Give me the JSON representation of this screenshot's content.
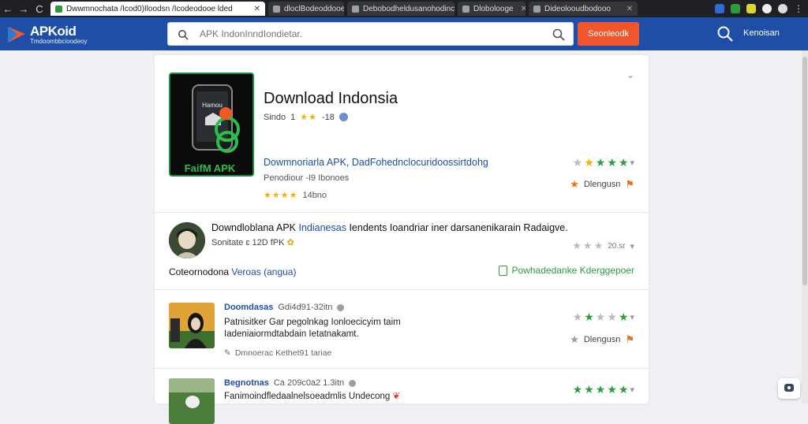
{
  "browser": {
    "nav": {
      "back": "←",
      "forward": "→",
      "reload": "C"
    },
    "tabs": [
      {
        "label": "Dwwmnochata /Icod0)Iloodsn /Icodeodooe lded",
        "active": true
      },
      {
        "label": "dloclBodeoddooe",
        "active": false
      },
      {
        "label": "Debobodheldusanohodinc",
        "active": false
      },
      {
        "label": "Dlobolooge",
        "active": false
      },
      {
        "label": "Dideolooudbodooo",
        "active": false
      }
    ]
  },
  "header": {
    "logo_title": "APKoid",
    "logo_sub": "Tmdoombbcioodeoy",
    "search_placeholder": "APK IndonInndIondietar.",
    "search_button": "Seonleodk",
    "header_link": "Kenoisan"
  },
  "app": {
    "title": "Download Indonsia",
    "meta_label": "Sindo",
    "meta_num": "1",
    "meta_count": "-18",
    "link_text": "Dowmnoriarla APK, DadFohednclocuridoossirtdohg",
    "sub_text": "Penodiour -I9 Ibonoes",
    "rating_label": "14bno",
    "icon_text": "FaifM APK",
    "icon_screen_text": "Hamou",
    "side_language": "Dlengusn"
  },
  "review": {
    "title_pre": "Downdloblana APK ",
    "title_hl": "Indianesas",
    "title_post": " Iendents Ioandriar iner darsanenikarain Radaigve.",
    "sub": "Sonitate ɛ 12D fPK",
    "rating_score": "20.sr",
    "footer_left_pre": "Coteornodona ",
    "footer_left_hl": "Veroas (angua)",
    "footer_right": "Powhadedanke Kderggepoer"
  },
  "comments": [
    {
      "name": "Doomdasas",
      "date": "Gdi4d91-32itn",
      "body": "Patnisitker Gar pegolnkag Ionloecicyim taim Iadeniaiormdtabdain Ietatnakamt.",
      "foot": "Dmnoerac Kethet91 tariae",
      "side_language": "Dlengusn"
    },
    {
      "name": "Begnotnas",
      "date": "Ca 209c0a2 1.3itn",
      "body": "Fanimoindfledaalnelsoeadmlis Undecong",
      "foot": "",
      "side_language": ""
    }
  ]
}
